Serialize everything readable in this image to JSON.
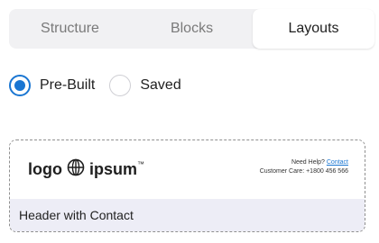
{
  "tabs": [
    {
      "label": "Structure",
      "active": false
    },
    {
      "label": "Blocks",
      "active": false
    },
    {
      "label": "Layouts",
      "active": true
    }
  ],
  "layout_source": {
    "options": [
      {
        "label": "Pre-Built",
        "checked": true
      },
      {
        "label": "Saved",
        "checked": false
      }
    ]
  },
  "card": {
    "preview": {
      "logo_left": "logo",
      "logo_right": "ipsum",
      "logo_mark": "™",
      "help_text": "Need Help?",
      "help_link": "Contact",
      "customer_care": "Customer Care: +1800 456 566"
    },
    "title": "Header with Contact"
  },
  "colors": {
    "accent": "#1a76d2",
    "tab_bar_bg": "#f1f1f3",
    "card_footer_bg": "#ededf6"
  },
  "icons": {
    "logo": "globe-icon"
  }
}
